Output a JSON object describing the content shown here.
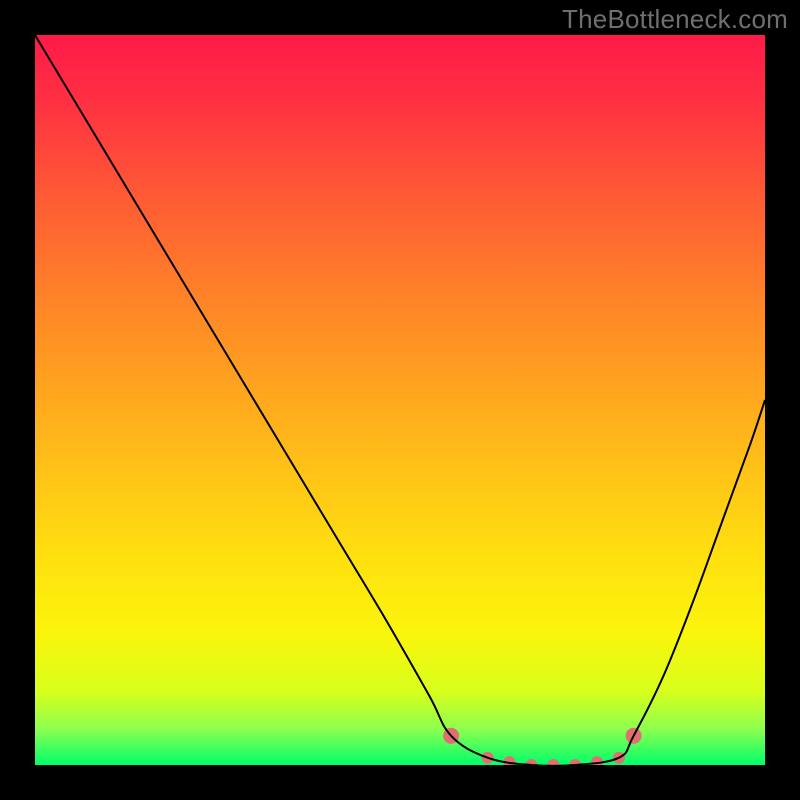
{
  "watermark": "TheBottleneck.com",
  "chart_data": {
    "type": "line",
    "title": "",
    "xlabel": "",
    "ylabel": "",
    "xlim": [
      0,
      1
    ],
    "ylim": [
      0,
      1
    ],
    "background": {
      "style": "vertical-gradient",
      "stops": [
        {
          "offset": 0.0,
          "color": "#ff1a49"
        },
        {
          "offset": 0.09,
          "color": "#ff3042"
        },
        {
          "offset": 0.22,
          "color": "#ff5a35"
        },
        {
          "offset": 0.35,
          "color": "#ff8029"
        },
        {
          "offset": 0.48,
          "color": "#ffa31f"
        },
        {
          "offset": 0.6,
          "color": "#ffc317"
        },
        {
          "offset": 0.72,
          "color": "#ffe10f"
        },
        {
          "offset": 0.82,
          "color": "#fbf50b"
        },
        {
          "offset": 0.9,
          "color": "#d7ff1c"
        },
        {
          "offset": 0.95,
          "color": "#8eff4e"
        },
        {
          "offset": 1.0,
          "color": "#00ff6a"
        }
      ]
    },
    "series": [
      {
        "name": "bottleneck-curve",
        "color": "#000000",
        "width": 2,
        "x": [
          0.0,
          0.06,
          0.12,
          0.18,
          0.24,
          0.3,
          0.36,
          0.42,
          0.48,
          0.54,
          0.57,
          0.62,
          0.68,
          0.74,
          0.8,
          0.82,
          0.86,
          0.9,
          0.94,
          0.98,
          1.0
        ],
        "y": [
          1.0,
          0.9,
          0.8,
          0.7,
          0.6,
          0.5,
          0.4,
          0.3,
          0.2,
          0.095,
          0.04,
          0.01,
          0.0,
          0.0,
          0.01,
          0.04,
          0.12,
          0.22,
          0.33,
          0.44,
          0.5
        ]
      }
    ],
    "markers": {
      "name": "min-band",
      "color": "#e0706f",
      "radius": 6,
      "cap_radius": 8,
      "x": [
        0.57,
        0.62,
        0.65,
        0.68,
        0.71,
        0.74,
        0.77,
        0.8,
        0.82
      ],
      "y": [
        0.04,
        0.01,
        0.004,
        0.0,
        0.0,
        0.0,
        0.004,
        0.01,
        0.04
      ]
    }
  }
}
